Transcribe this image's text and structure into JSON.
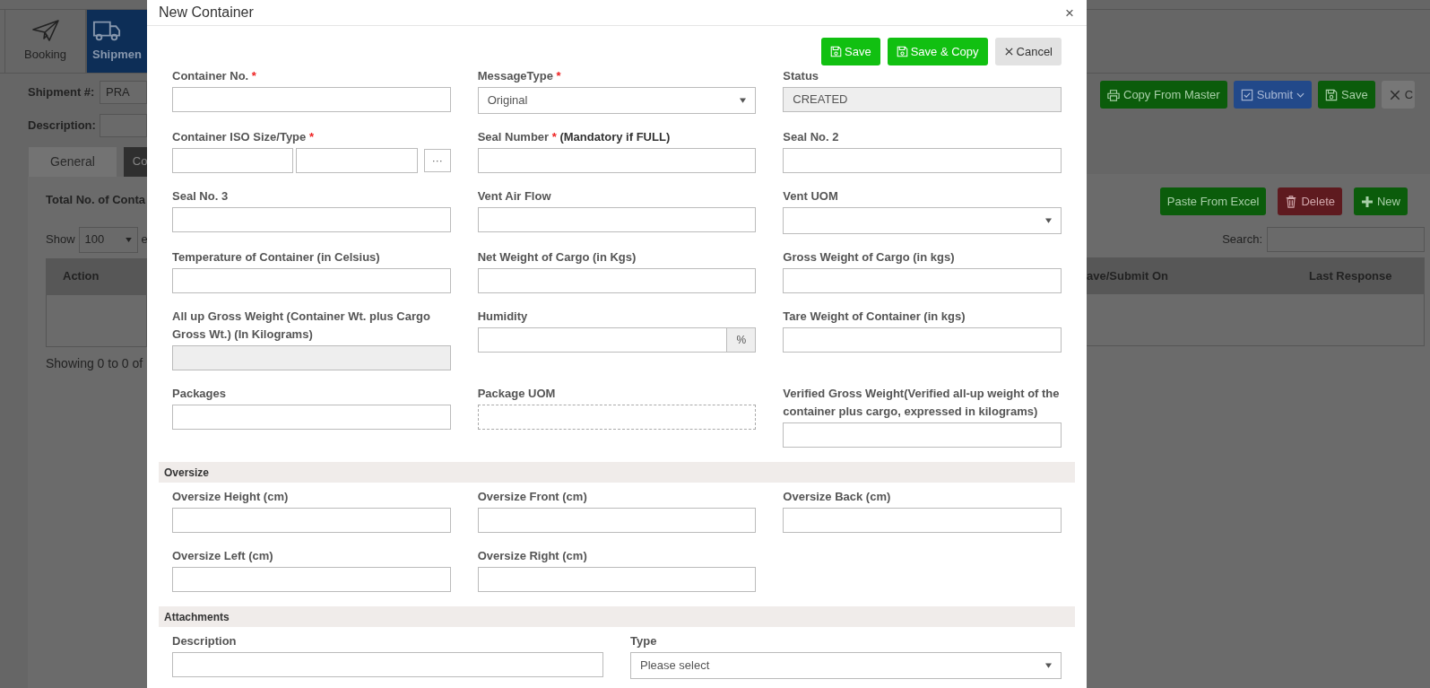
{
  "left_page": {
    "nav_tiles": [
      {
        "label": "Booking",
        "selected": false
      },
      {
        "label": "Shipmen",
        "selected": true
      }
    ],
    "shipment_label": "Shipment #:",
    "shipment_value": "PRA",
    "description_label": "Description:",
    "tabs": [
      {
        "label": "General",
        "selected": false
      },
      {
        "label": "Co",
        "selected": true
      }
    ],
    "total_label": "Total No. of Conta",
    "show_label": "Show",
    "page_size": "100",
    "entries_label": "e",
    "columns": [
      "Action"
    ],
    "footer": "Showing 0 to 0 of"
  },
  "modal": {
    "title": "New Container",
    "close": "×",
    "actions": [
      {
        "label": "Save",
        "kind": "save"
      },
      {
        "label": "Save & Copy",
        "kind": "save"
      },
      {
        "label": "Cancel",
        "kind": "cancel"
      }
    ],
    "sections": [
      {
        "rows": [
          [
            {
              "label": "Container No.",
              "required": "*",
              "kind": "text"
            },
            {
              "label": "MessageType",
              "required": "*",
              "kind": "select",
              "value": "Original"
            },
            {
              "label": "Status",
              "kind": "readonly",
              "value": "CREATED"
            }
          ],
          [
            {
              "label": "Container ISO Size/Type",
              "required": "*",
              "kind": "iso",
              "button_label": "···"
            },
            {
              "label": "Seal Number",
              "required": "*",
              "note": "(Mandatory if FULL)",
              "kind": "text"
            },
            {
              "label": "Seal No. 2",
              "kind": "text"
            }
          ],
          [
            {
              "label": "Seal No. 3",
              "kind": "text"
            },
            {
              "label": "Vent Air Flow",
              "kind": "text"
            },
            {
              "label": "Vent UOM",
              "kind": "select"
            }
          ],
          [
            {
              "label": "Temperature of Container (in Celsius)",
              "kind": "text"
            },
            {
              "label": "Net Weight of Cargo (in Kgs)",
              "kind": "text"
            },
            {
              "label": "Gross Weight of Cargo (in kgs)",
              "kind": "text"
            }
          ],
          [
            {
              "label": "All up Gross Weight (Container Wt. plus Cargo Gross Wt.) (In Kilograms)",
              "kind": "readonly"
            },
            {
              "label": "Humidity",
              "kind": "percent",
              "addon": "%"
            },
            {
              "label": "Tare Weight of Container (in kgs)",
              "kind": "text"
            }
          ],
          [
            {
              "label": "Packages",
              "kind": "text"
            },
            {
              "label": "Package UOM",
              "kind": "dashed"
            },
            {
              "label": "Verified Gross Weight(Verified all-up weight of the container plus cargo, expressed in kilograms)",
              "kind": "text"
            }
          ]
        ]
      },
      {
        "heading": "Oversize",
        "rows": [
          [
            {
              "label": "Oversize Height (cm)",
              "kind": "text"
            },
            {
              "label": "Oversize Front (cm)",
              "kind": "text"
            },
            {
              "label": "Oversize Back (cm)",
              "kind": "text"
            }
          ],
          [
            {
              "label": "Oversize Left (cm)",
              "kind": "text"
            },
            {
              "label": "Oversize Right (cm)",
              "kind": "text"
            }
          ]
        ]
      },
      {
        "heading": "Attachments",
        "rows": [
          [
            {
              "label": "Description",
              "kind": "text"
            },
            {
              "label": "Type",
              "kind": "select",
              "value": "Please select"
            }
          ]
        ]
      }
    ]
  },
  "right_page": {
    "toolbar": [
      {
        "label": "Copy From Master",
        "kind": "success"
      },
      {
        "label": "Submit",
        "kind": "primary",
        "caret": true
      },
      {
        "label": "Save",
        "kind": "success"
      },
      {
        "label": "C",
        "kind": "secondary"
      }
    ],
    "table_actions": [
      {
        "label": "Paste From Excel",
        "kind": "success"
      },
      {
        "label": "Delete",
        "kind": "danger"
      },
      {
        "label": "New",
        "kind": "success"
      }
    ],
    "search_label": "Search:",
    "columns": [
      "ave/Submit On",
      "Last Response"
    ]
  }
}
